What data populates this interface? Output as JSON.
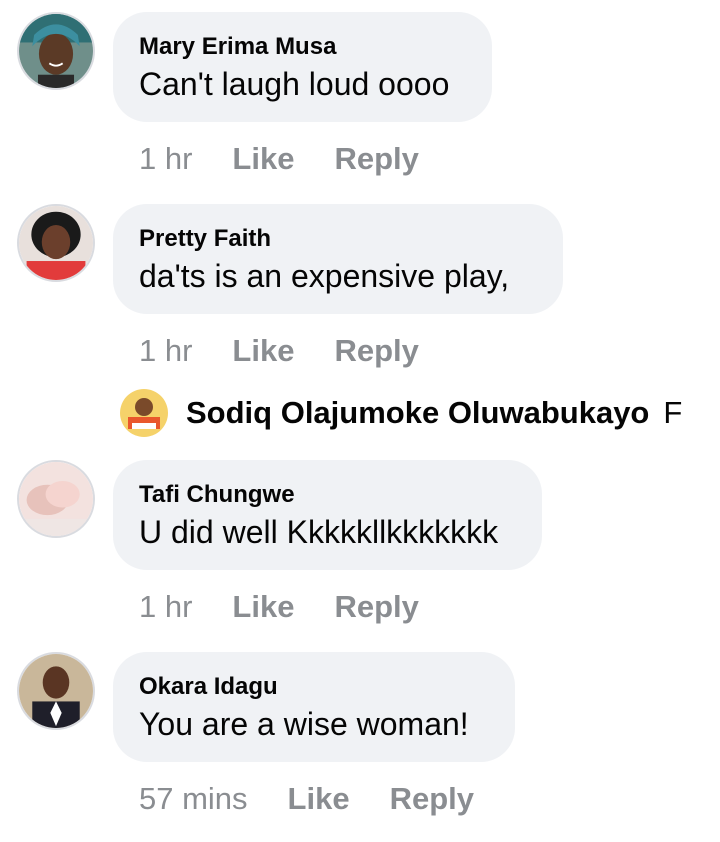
{
  "comments": [
    {
      "author": "Mary Erima Musa",
      "text": "Can't laugh loud oooo",
      "time": "1 hr",
      "like": "Like",
      "reply": "Reply"
    },
    {
      "author": "Pretty Faith",
      "text": "da'ts is an expensive play,",
      "time": "1 hr",
      "like": "Like",
      "reply": "Reply"
    },
    {
      "author": "Tafi Chungwe",
      "text": "U did well Kkkkkllkkkkkkk",
      "time": "1 hr",
      "like": "Like",
      "reply": "Reply"
    },
    {
      "author": "Okara Idagu",
      "text": "You are a wise woman!",
      "time": "57 mins",
      "like": "Like",
      "reply": "Reply"
    }
  ],
  "reply_preview": {
    "author": "Sodiq Olajumoke Oluwabukayo",
    "trailing": "F"
  }
}
